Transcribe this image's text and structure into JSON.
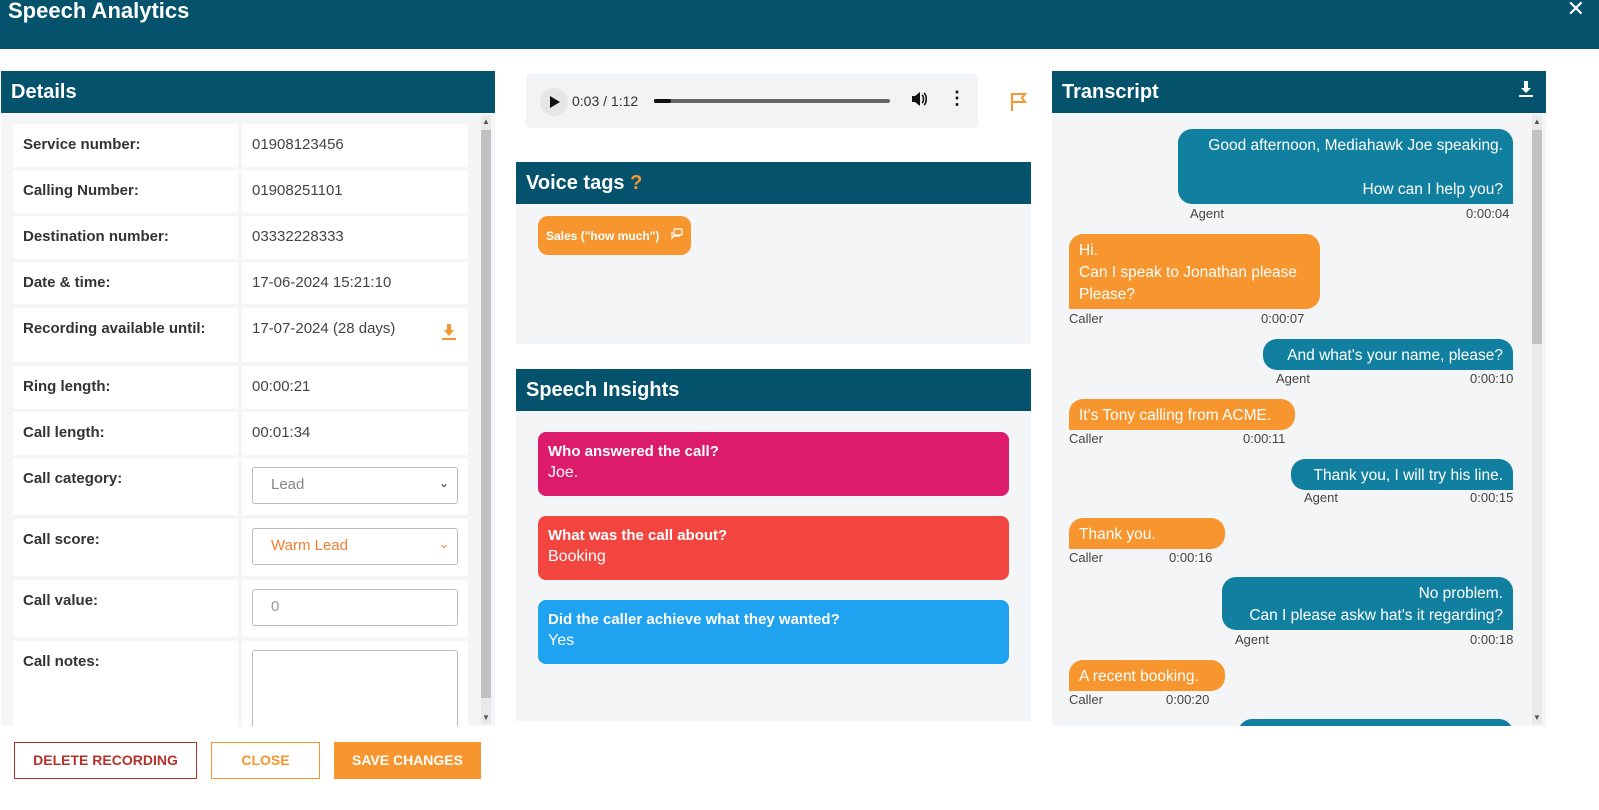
{
  "window": {
    "title": "Speech Analytics",
    "close_glyph": "✕"
  },
  "details": {
    "title": "Details",
    "rows": [
      {
        "label": "Service number:",
        "value": "01908123456"
      },
      {
        "label": "Calling Number:",
        "value": "01908251101"
      },
      {
        "label": "Destination number:",
        "value": "03332228333"
      },
      {
        "label": "Date & time:",
        "value": "17-06-2024 15:21:10"
      },
      {
        "label": "Recording available until:",
        "value": "17-07-2024 (28 days)"
      },
      {
        "label": "Ring length:",
        "value": "00:00:21"
      },
      {
        "label": "Call length:",
        "value": "00:01:34"
      }
    ],
    "call_category": {
      "label": "Call category:",
      "selected": "Lead"
    },
    "call_score": {
      "label": "Call score:",
      "selected": "Warm Lead"
    },
    "call_value": {
      "label": "Call value:",
      "placeholder": "0"
    },
    "call_notes": {
      "label": "Call notes:"
    }
  },
  "audio": {
    "time": "0:03 / 1:12",
    "progress": 0.07
  },
  "voice_tags": {
    "title": "Voice tags",
    "help": "?",
    "tags": [
      {
        "label": "Sales (\"how much\")"
      }
    ]
  },
  "insights": {
    "title": "Speech Insights",
    "cards": [
      {
        "question": "Who answered the call?",
        "answer": "Joe.",
        "color": "#dc1b6b"
      },
      {
        "question": "What was the call about?",
        "answer": "Booking",
        "color": "#f2453f"
      },
      {
        "question": "Did the caller achieve what they wanted?",
        "answer": "Yes",
        "color": "#1fa2ef"
      }
    ]
  },
  "transcript": {
    "title": "Transcript",
    "messages": [
      {
        "speaker": "Agent",
        "time": "0:00:04",
        "line1": "Good afternoon, Mediahawk Joe speaking.",
        "line2": "",
        "line3": "How can I help you?"
      },
      {
        "speaker": "Caller",
        "time": "0:00:07",
        "line1": "Hi.",
        "line2": "Can I speak to Jonathan please",
        "line3": "Please?"
      },
      {
        "speaker": "Agent",
        "time": "0:00:10",
        "line1": "And what's your name, please?"
      },
      {
        "speaker": "Caller",
        "time": "0:00:11",
        "line1": "It's Tony calling from ACME."
      },
      {
        "speaker": "Agent",
        "time": "0:00:15",
        "line1": "Thank you, I will try his line."
      },
      {
        "speaker": "Caller",
        "time": "0:00:16",
        "line1": "Thank you."
      },
      {
        "speaker": "Agent",
        "time": "0:00:18",
        "line1": "No problem.",
        "line2": "Can I please askw hat's it regarding?"
      },
      {
        "speaker": "Caller",
        "time": "0:00:20",
        "line1": "A recent booking."
      }
    ]
  },
  "buttons": {
    "delete": "DELETE RECORDING",
    "close": "CLOSE",
    "save": "SAVE CHANGES"
  }
}
